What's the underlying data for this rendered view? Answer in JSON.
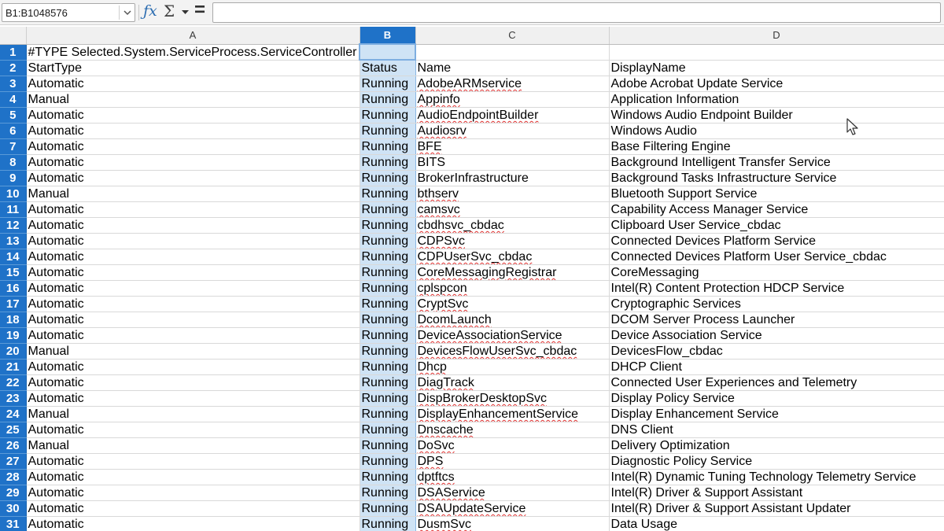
{
  "formula_bar": {
    "name_box": "B1:B1048576",
    "formula": ""
  },
  "icons": {
    "function_wizard": "fx-icon",
    "sum": "sigma-icon",
    "formula": "equals-icon"
  },
  "colors": {
    "selection_header": "#1f72c8",
    "selection_fill": "#cfe3f5"
  },
  "columns": [
    "A",
    "B",
    "C",
    "D"
  ],
  "rows": [
    {
      "n": "1",
      "a": "#TYPE Selected.System.ServiceProcess.ServiceController",
      "b": "",
      "c": "",
      "d": ""
    },
    {
      "n": "2",
      "a": "StartType",
      "b": "Status",
      "c": "Name",
      "d": "DisplayName"
    },
    {
      "n": "3",
      "a": "Automatic",
      "b": "Running",
      "c": "AdobeARMservice",
      "d": "Adobe Acrobat Update Service"
    },
    {
      "n": "4",
      "a": "Manual",
      "b": "Running",
      "c": "Appinfo",
      "d": "Application Information"
    },
    {
      "n": "5",
      "a": "Automatic",
      "b": "Running",
      "c": "AudioEndpointBuilder",
      "d": "Windows Audio Endpoint Builder"
    },
    {
      "n": "6",
      "a": "Automatic",
      "b": "Running",
      "c": "Audiosrv",
      "d": "Windows Audio"
    },
    {
      "n": "7",
      "a": "Automatic",
      "b": "Running",
      "c": "BFE",
      "d": "Base Filtering Engine"
    },
    {
      "n": "8",
      "a": "Automatic",
      "b": "Running",
      "c": "BITS",
      "d": "Background Intelligent Transfer Service"
    },
    {
      "n": "9",
      "a": "Automatic",
      "b": "Running",
      "c": "BrokerInfrastructure",
      "d": "Background Tasks Infrastructure Service"
    },
    {
      "n": "10",
      "a": "Manual",
      "b": "Running",
      "c": "bthserv",
      "d": "Bluetooth Support Service"
    },
    {
      "n": "11",
      "a": "Automatic",
      "b": "Running",
      "c": "camsvc",
      "d": "Capability Access Manager Service"
    },
    {
      "n": "12",
      "a": "Automatic",
      "b": "Running",
      "c": "cbdhsvc_cbdac",
      "d": "Clipboard User Service_cbdac"
    },
    {
      "n": "13",
      "a": "Automatic",
      "b": "Running",
      "c": "CDPSvc",
      "d": "Connected Devices Platform Service"
    },
    {
      "n": "14",
      "a": "Automatic",
      "b": "Running",
      "c": "CDPUserSvc_cbdac",
      "d": "Connected Devices Platform User Service_cbdac"
    },
    {
      "n": "15",
      "a": "Automatic",
      "b": "Running",
      "c": "CoreMessagingRegistrar",
      "d": "CoreMessaging"
    },
    {
      "n": "16",
      "a": "Automatic",
      "b": "Running",
      "c": "cplspcon",
      "d": "Intel(R) Content Protection HDCP Service"
    },
    {
      "n": "17",
      "a": "Automatic",
      "b": "Running",
      "c": "CryptSvc",
      "d": "Cryptographic Services"
    },
    {
      "n": "18",
      "a": "Automatic",
      "b": "Running",
      "c": "DcomLaunch",
      "d": "DCOM Server Process Launcher"
    },
    {
      "n": "19",
      "a": "Automatic",
      "b": "Running",
      "c": "DeviceAssociationService",
      "d": "Device Association Service"
    },
    {
      "n": "20",
      "a": "Manual",
      "b": "Running",
      "c": "DevicesFlowUserSvc_cbdac",
      "d": "DevicesFlow_cbdac"
    },
    {
      "n": "21",
      "a": "Automatic",
      "b": "Running",
      "c": "Dhcp",
      "d": "DHCP Client"
    },
    {
      "n": "22",
      "a": "Automatic",
      "b": "Running",
      "c": "DiagTrack",
      "d": "Connected User Experiences and Telemetry"
    },
    {
      "n": "23",
      "a": "Automatic",
      "b": "Running",
      "c": "DispBrokerDesktopSvc",
      "d": "Display Policy Service"
    },
    {
      "n": "24",
      "a": "Manual",
      "b": "Running",
      "c": "DisplayEnhancementService",
      "d": "Display Enhancement Service"
    },
    {
      "n": "25",
      "a": "Automatic",
      "b": "Running",
      "c": "Dnscache",
      "d": "DNS Client"
    },
    {
      "n": "26",
      "a": "Manual",
      "b": "Running",
      "c": "DoSvc",
      "d": "Delivery Optimization"
    },
    {
      "n": "27",
      "a": "Automatic",
      "b": "Running",
      "c": "DPS",
      "d": "Diagnostic Policy Service"
    },
    {
      "n": "28",
      "a": "Automatic",
      "b": "Running",
      "c": "dptftcs",
      "d": "Intel(R) Dynamic Tuning Technology Telemetry Service"
    },
    {
      "n": "29",
      "a": "Automatic",
      "b": "Running",
      "c": "DSAService",
      "d": "Intel(R) Driver & Support Assistant"
    },
    {
      "n": "30",
      "a": "Automatic",
      "b": "Running",
      "c": "DSAUpdateService",
      "d": "Intel(R) Driver & Support Assistant Updater"
    },
    {
      "n": "31",
      "a": "Automatic",
      "b": "Running",
      "c": "DusmSvc",
      "d": "Data Usage"
    }
  ]
}
